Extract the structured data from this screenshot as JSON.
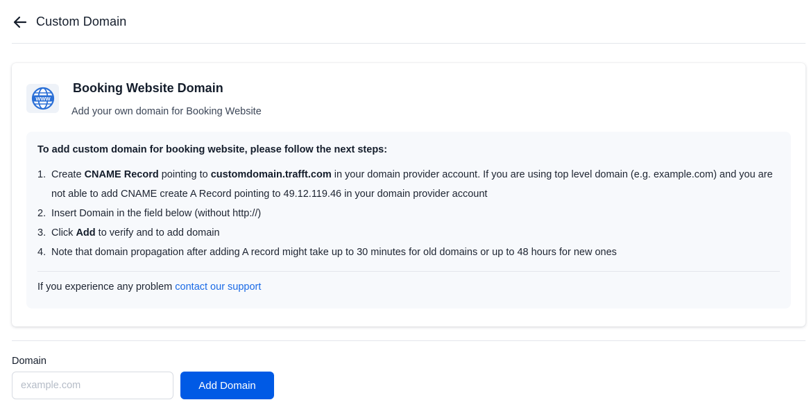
{
  "header": {
    "back_icon": "arrow-left-icon",
    "title": "Custom Domain"
  },
  "card": {
    "icon": "www-globe-icon",
    "icon_text": "WWW",
    "title": "Booking Website Domain",
    "subtitle": "Add your own domain for Booking Website",
    "instructions": {
      "heading": "To add custom domain for booking website, please follow the next steps:",
      "steps": [
        {
          "num": "1.",
          "pre": "Create ",
          "bold1": "CNAME Record",
          "mid": " pointing to ",
          "bold2": "customdomain.trafft.com",
          "post": " in your domain provider account. If you are using top level domain (e.g. example.com) and you are not able to add CNAME create A Record pointing to 49.12.119.46 in your domain provider account"
        },
        {
          "num": "2.",
          "text": "Insert Domain in the field below (without http://)"
        },
        {
          "num": "3.",
          "pre": "Click ",
          "bold": "Add",
          "post": " to verify and to add domain"
        },
        {
          "num": "4.",
          "text": "Note that domain propagation after adding A record might take up to 30 minutes for old domains or up to 48 hours for new ones"
        }
      ],
      "support_prefix": "If you experience any problem ",
      "support_link": "contact our support"
    }
  },
  "form": {
    "label": "Domain",
    "placeholder": "example.com",
    "value": "",
    "button_label": "Add Domain"
  },
  "colors": {
    "primary": "#005ae5",
    "link": "#1a6ae6",
    "icon_blue": "#2a6fd6"
  }
}
